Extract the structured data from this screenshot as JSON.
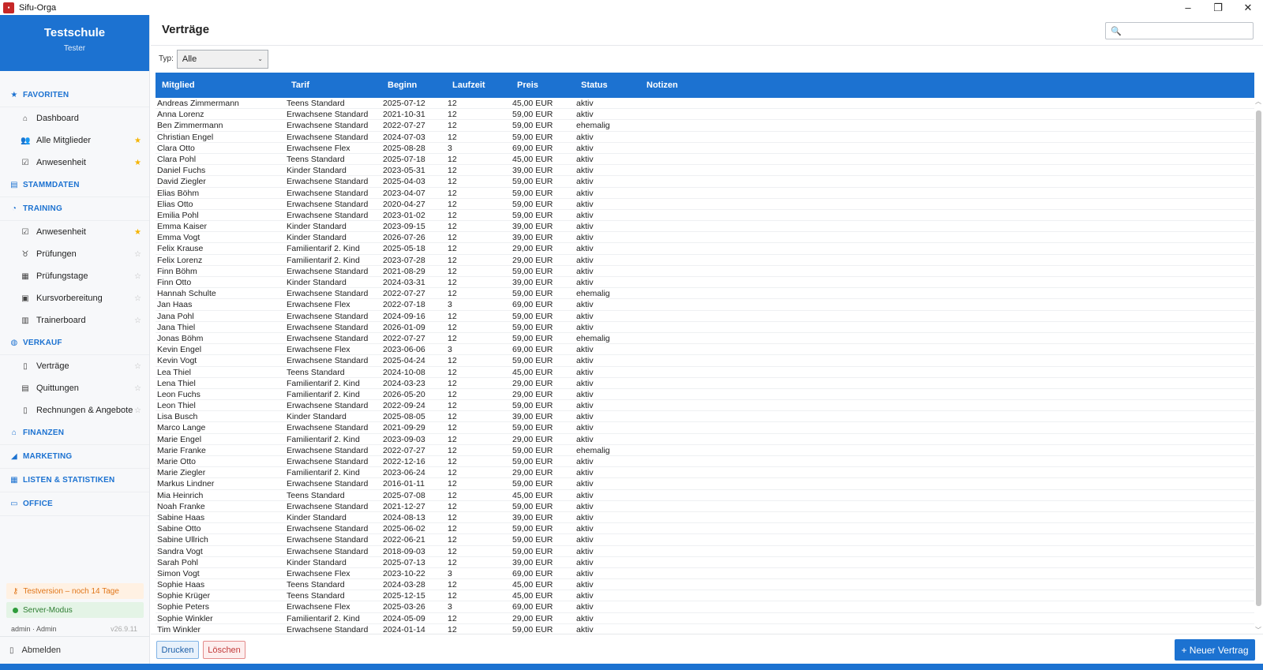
{
  "window": {
    "title": "Sifu-Orga",
    "controls": [
      "minimize",
      "maximize",
      "close"
    ]
  },
  "brand": {
    "name": "Testschule",
    "user": "Tester"
  },
  "nav": {
    "favoriten": {
      "label": "FAVORITEN",
      "items": [
        {
          "label": "Dashboard",
          "icon": "home-icon",
          "fav": null
        },
        {
          "label": "Alle Mitglieder",
          "icon": "users-icon",
          "fav": true
        },
        {
          "label": "Anwesenheit",
          "icon": "checkbox-icon",
          "fav": true
        }
      ]
    },
    "stammdaten": {
      "label": "STAMMDATEN"
    },
    "training": {
      "label": "TRAINING",
      "items": [
        {
          "label": "Anwesenheit",
          "icon": "checkbox-icon",
          "fav": true
        },
        {
          "label": "Prüfungen",
          "icon": "medal-icon",
          "fav": false
        },
        {
          "label": "Prüfungstage",
          "icon": "calendar-icon",
          "fav": false
        },
        {
          "label": "Kursvorbereitung",
          "icon": "clipboard-icon",
          "fav": false
        },
        {
          "label": "Trainerboard",
          "icon": "chart-icon",
          "fav": false
        }
      ]
    },
    "verkauf": {
      "label": "VERKAUF",
      "items": [
        {
          "label": "Verträge",
          "icon": "document-icon",
          "fav": false
        },
        {
          "label": "Quittungen",
          "icon": "receipt-icon",
          "fav": false
        },
        {
          "label": "Rechnungen & Angebote",
          "icon": "invoice-icon",
          "fav": false
        }
      ]
    },
    "finanzen": {
      "label": "FINANZEN"
    },
    "marketing": {
      "label": "MARKETING"
    },
    "listen": {
      "label": "LISTEN & STATISTIKEN"
    },
    "office": {
      "label": "OFFICE"
    }
  },
  "sidebar_bottom": {
    "trial": "Testversion – noch 14 Tage",
    "server": "Server-Modus",
    "user": "admin · Admin",
    "version": "v26.9.11",
    "logout": "Abmelden"
  },
  "page": {
    "title": "Verträge",
    "search_placeholder": ""
  },
  "filter": {
    "label": "Typ:",
    "value": "Alle"
  },
  "table": {
    "columns": [
      "Mitglied",
      "Tarif",
      "Beginn",
      "Laufzeit",
      "Preis",
      "Status",
      "Notizen"
    ],
    "rows": [
      [
        "Andreas Zimmermann",
        "Teens Standard",
        "2025-07-12",
        "12",
        "45,00 EUR",
        "aktiv",
        ""
      ],
      [
        "Anna Lorenz",
        "Erwachsene Standard",
        "2021-10-31",
        "12",
        "59,00 EUR",
        "aktiv",
        ""
      ],
      [
        "Ben Zimmermann",
        "Erwachsene Standard",
        "2022-07-27",
        "12",
        "59,00 EUR",
        "ehemalig",
        ""
      ],
      [
        "Christian Engel",
        "Erwachsene Standard",
        "2024-07-03",
        "12",
        "59,00 EUR",
        "aktiv",
        ""
      ],
      [
        "Clara Otto",
        "Erwachsene Flex",
        "2025-08-28",
        "3",
        "69,00 EUR",
        "aktiv",
        ""
      ],
      [
        "Clara Pohl",
        "Teens Standard",
        "2025-07-18",
        "12",
        "45,00 EUR",
        "aktiv",
        ""
      ],
      [
        "Daniel Fuchs",
        "Kinder Standard",
        "2023-05-31",
        "12",
        "39,00 EUR",
        "aktiv",
        ""
      ],
      [
        "David Ziegler",
        "Erwachsene Standard",
        "2025-04-03",
        "12",
        "59,00 EUR",
        "aktiv",
        ""
      ],
      [
        "Elias Böhm",
        "Erwachsene Standard",
        "2023-04-07",
        "12",
        "59,00 EUR",
        "aktiv",
        ""
      ],
      [
        "Elias Otto",
        "Erwachsene Standard",
        "2020-04-27",
        "12",
        "59,00 EUR",
        "aktiv",
        ""
      ],
      [
        "Emilia Pohl",
        "Erwachsene Standard",
        "2023-01-02",
        "12",
        "59,00 EUR",
        "aktiv",
        ""
      ],
      [
        "Emma Kaiser",
        "Kinder Standard",
        "2023-09-15",
        "12",
        "39,00 EUR",
        "aktiv",
        ""
      ],
      [
        "Emma Vogt",
        "Kinder Standard",
        "2026-07-26",
        "12",
        "39,00 EUR",
        "aktiv",
        ""
      ],
      [
        "Felix Krause",
        "Familientarif 2. Kind",
        "2025-05-18",
        "12",
        "29,00 EUR",
        "aktiv",
        ""
      ],
      [
        "Felix Lorenz",
        "Familientarif 2. Kind",
        "2023-07-28",
        "12",
        "29,00 EUR",
        "aktiv",
        ""
      ],
      [
        "Finn Böhm",
        "Erwachsene Standard",
        "2021-08-29",
        "12",
        "59,00 EUR",
        "aktiv",
        ""
      ],
      [
        "Finn Otto",
        "Kinder Standard",
        "2024-03-31",
        "12",
        "39,00 EUR",
        "aktiv",
        ""
      ],
      [
        "Hannah Schulte",
        "Erwachsene Standard",
        "2022-07-27",
        "12",
        "59,00 EUR",
        "ehemalig",
        ""
      ],
      [
        "Jan Haas",
        "Erwachsene Flex",
        "2022-07-18",
        "3",
        "69,00 EUR",
        "aktiv",
        ""
      ],
      [
        "Jana Pohl",
        "Erwachsene Standard",
        "2024-09-16",
        "12",
        "59,00 EUR",
        "aktiv",
        ""
      ],
      [
        "Jana Thiel",
        "Erwachsene Standard",
        "2026-01-09",
        "12",
        "59,00 EUR",
        "aktiv",
        ""
      ],
      [
        "Jonas Böhm",
        "Erwachsene Standard",
        "2022-07-27",
        "12",
        "59,00 EUR",
        "ehemalig",
        ""
      ],
      [
        "Kevin Engel",
        "Erwachsene Flex",
        "2023-06-06",
        "3",
        "69,00 EUR",
        "aktiv",
        ""
      ],
      [
        "Kevin Vogt",
        "Erwachsene Standard",
        "2025-04-24",
        "12",
        "59,00 EUR",
        "aktiv",
        ""
      ],
      [
        "Lea Thiel",
        "Teens Standard",
        "2024-10-08",
        "12",
        "45,00 EUR",
        "aktiv",
        ""
      ],
      [
        "Lena Thiel",
        "Familientarif 2. Kind",
        "2024-03-23",
        "12",
        "29,00 EUR",
        "aktiv",
        ""
      ],
      [
        "Leon Fuchs",
        "Familientarif 2. Kind",
        "2026-05-20",
        "12",
        "29,00 EUR",
        "aktiv",
        ""
      ],
      [
        "Leon Thiel",
        "Erwachsene Standard",
        "2022-09-24",
        "12",
        "59,00 EUR",
        "aktiv",
        ""
      ],
      [
        "Lisa Busch",
        "Kinder Standard",
        "2025-08-05",
        "12",
        "39,00 EUR",
        "aktiv",
        ""
      ],
      [
        "Marco Lange",
        "Erwachsene Standard",
        "2021-09-29",
        "12",
        "59,00 EUR",
        "aktiv",
        ""
      ],
      [
        "Marie Engel",
        "Familientarif 2. Kind",
        "2023-09-03",
        "12",
        "29,00 EUR",
        "aktiv",
        ""
      ],
      [
        "Marie Franke",
        "Erwachsene Standard",
        "2022-07-27",
        "12",
        "59,00 EUR",
        "ehemalig",
        ""
      ],
      [
        "Marie Otto",
        "Erwachsene Standard",
        "2022-12-16",
        "12",
        "59,00 EUR",
        "aktiv",
        ""
      ],
      [
        "Marie Ziegler",
        "Familientarif 2. Kind",
        "2023-06-24",
        "12",
        "29,00 EUR",
        "aktiv",
        ""
      ],
      [
        "Markus Lindner",
        "Erwachsene Standard",
        "2016-01-11",
        "12",
        "59,00 EUR",
        "aktiv",
        ""
      ],
      [
        "Mia Heinrich",
        "Teens Standard",
        "2025-07-08",
        "12",
        "45,00 EUR",
        "aktiv",
        ""
      ],
      [
        "Noah Franke",
        "Erwachsene Standard",
        "2021-12-27",
        "12",
        "59,00 EUR",
        "aktiv",
        ""
      ],
      [
        "Sabine Haas",
        "Kinder Standard",
        "2024-08-13",
        "12",
        "39,00 EUR",
        "aktiv",
        ""
      ],
      [
        "Sabine Otto",
        "Erwachsene Standard",
        "2025-06-02",
        "12",
        "59,00 EUR",
        "aktiv",
        ""
      ],
      [
        "Sabine Ullrich",
        "Erwachsene Standard",
        "2022-06-21",
        "12",
        "59,00 EUR",
        "aktiv",
        ""
      ],
      [
        "Sandra Vogt",
        "Erwachsene Standard",
        "2018-09-03",
        "12",
        "59,00 EUR",
        "aktiv",
        ""
      ],
      [
        "Sarah Pohl",
        "Kinder Standard",
        "2025-07-13",
        "12",
        "39,00 EUR",
        "aktiv",
        ""
      ],
      [
        "Simon Vogt",
        "Erwachsene Flex",
        "2023-10-22",
        "3",
        "69,00 EUR",
        "aktiv",
        ""
      ],
      [
        "Sophie Haas",
        "Teens Standard",
        "2024-03-28",
        "12",
        "45,00 EUR",
        "aktiv",
        ""
      ],
      [
        "Sophie Krüger",
        "Teens Standard",
        "2025-12-15",
        "12",
        "45,00 EUR",
        "aktiv",
        ""
      ],
      [
        "Sophie Peters",
        "Erwachsene Flex",
        "2025-03-26",
        "3",
        "69,00 EUR",
        "aktiv",
        ""
      ],
      [
        "Sophie Winkler",
        "Familientarif 2. Kind",
        "2024-05-09",
        "12",
        "29,00 EUR",
        "aktiv",
        ""
      ],
      [
        "Tim Winkler",
        "Erwachsene Standard",
        "2024-01-14",
        "12",
        "59,00 EUR",
        "aktiv",
        ""
      ]
    ]
  },
  "actions": {
    "print": "Drucken",
    "delete": "Löschen",
    "new": "+ Neuer Vertrag"
  },
  "colors": {
    "accent": "#1c72d1",
    "favorite": "#f5b400",
    "trial": "#e0761a",
    "server": "#2e7d32"
  }
}
